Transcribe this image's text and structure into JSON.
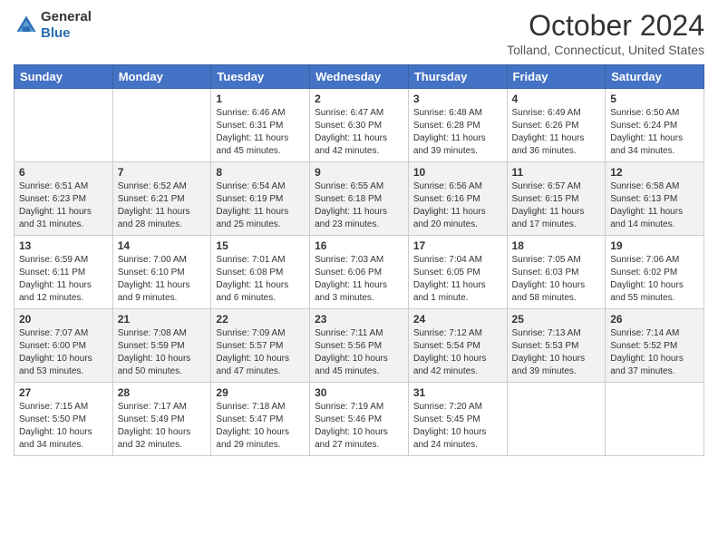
{
  "header": {
    "logo_general": "General",
    "logo_blue": "Blue",
    "month_year": "October 2024",
    "location": "Tolland, Connecticut, United States"
  },
  "weekdays": [
    "Sunday",
    "Monday",
    "Tuesday",
    "Wednesday",
    "Thursday",
    "Friday",
    "Saturday"
  ],
  "weeks": [
    [
      null,
      null,
      {
        "day": "1",
        "sunrise": "6:46 AM",
        "sunset": "6:31 PM",
        "daylight": "11 hours and 45 minutes."
      },
      {
        "day": "2",
        "sunrise": "6:47 AM",
        "sunset": "6:30 PM",
        "daylight": "11 hours and 42 minutes."
      },
      {
        "day": "3",
        "sunrise": "6:48 AM",
        "sunset": "6:28 PM",
        "daylight": "11 hours and 39 minutes."
      },
      {
        "day": "4",
        "sunrise": "6:49 AM",
        "sunset": "6:26 PM",
        "daylight": "11 hours and 36 minutes."
      },
      {
        "day": "5",
        "sunrise": "6:50 AM",
        "sunset": "6:24 PM",
        "daylight": "11 hours and 34 minutes."
      }
    ],
    [
      {
        "day": "6",
        "sunrise": "6:51 AM",
        "sunset": "6:23 PM",
        "daylight": "11 hours and 31 minutes."
      },
      {
        "day": "7",
        "sunrise": "6:52 AM",
        "sunset": "6:21 PM",
        "daylight": "11 hours and 28 minutes."
      },
      {
        "day": "8",
        "sunrise": "6:54 AM",
        "sunset": "6:19 PM",
        "daylight": "11 hours and 25 minutes."
      },
      {
        "day": "9",
        "sunrise": "6:55 AM",
        "sunset": "6:18 PM",
        "daylight": "11 hours and 23 minutes."
      },
      {
        "day": "10",
        "sunrise": "6:56 AM",
        "sunset": "6:16 PM",
        "daylight": "11 hours and 20 minutes."
      },
      {
        "day": "11",
        "sunrise": "6:57 AM",
        "sunset": "6:15 PM",
        "daylight": "11 hours and 17 minutes."
      },
      {
        "day": "12",
        "sunrise": "6:58 AM",
        "sunset": "6:13 PM",
        "daylight": "11 hours and 14 minutes."
      }
    ],
    [
      {
        "day": "13",
        "sunrise": "6:59 AM",
        "sunset": "6:11 PM",
        "daylight": "11 hours and 12 minutes."
      },
      {
        "day": "14",
        "sunrise": "7:00 AM",
        "sunset": "6:10 PM",
        "daylight": "11 hours and 9 minutes."
      },
      {
        "day": "15",
        "sunrise": "7:01 AM",
        "sunset": "6:08 PM",
        "daylight": "11 hours and 6 minutes."
      },
      {
        "day": "16",
        "sunrise": "7:03 AM",
        "sunset": "6:06 PM",
        "daylight": "11 hours and 3 minutes."
      },
      {
        "day": "17",
        "sunrise": "7:04 AM",
        "sunset": "6:05 PM",
        "daylight": "11 hours and 1 minute."
      },
      {
        "day": "18",
        "sunrise": "7:05 AM",
        "sunset": "6:03 PM",
        "daylight": "10 hours and 58 minutes."
      },
      {
        "day": "19",
        "sunrise": "7:06 AM",
        "sunset": "6:02 PM",
        "daylight": "10 hours and 55 minutes."
      }
    ],
    [
      {
        "day": "20",
        "sunrise": "7:07 AM",
        "sunset": "6:00 PM",
        "daylight": "10 hours and 53 minutes."
      },
      {
        "day": "21",
        "sunrise": "7:08 AM",
        "sunset": "5:59 PM",
        "daylight": "10 hours and 50 minutes."
      },
      {
        "day": "22",
        "sunrise": "7:09 AM",
        "sunset": "5:57 PM",
        "daylight": "10 hours and 47 minutes."
      },
      {
        "day": "23",
        "sunrise": "7:11 AM",
        "sunset": "5:56 PM",
        "daylight": "10 hours and 45 minutes."
      },
      {
        "day": "24",
        "sunrise": "7:12 AM",
        "sunset": "5:54 PM",
        "daylight": "10 hours and 42 minutes."
      },
      {
        "day": "25",
        "sunrise": "7:13 AM",
        "sunset": "5:53 PM",
        "daylight": "10 hours and 39 minutes."
      },
      {
        "day": "26",
        "sunrise": "7:14 AM",
        "sunset": "5:52 PM",
        "daylight": "10 hours and 37 minutes."
      }
    ],
    [
      {
        "day": "27",
        "sunrise": "7:15 AM",
        "sunset": "5:50 PM",
        "daylight": "10 hours and 34 minutes."
      },
      {
        "day": "28",
        "sunrise": "7:17 AM",
        "sunset": "5:49 PM",
        "daylight": "10 hours and 32 minutes."
      },
      {
        "day": "29",
        "sunrise": "7:18 AM",
        "sunset": "5:47 PM",
        "daylight": "10 hours and 29 minutes."
      },
      {
        "day": "30",
        "sunrise": "7:19 AM",
        "sunset": "5:46 PM",
        "daylight": "10 hours and 27 minutes."
      },
      {
        "day": "31",
        "sunrise": "7:20 AM",
        "sunset": "5:45 PM",
        "daylight": "10 hours and 24 minutes."
      },
      null,
      null
    ]
  ],
  "labels": {
    "sunrise": "Sunrise:",
    "sunset": "Sunset:",
    "daylight": "Daylight:"
  }
}
